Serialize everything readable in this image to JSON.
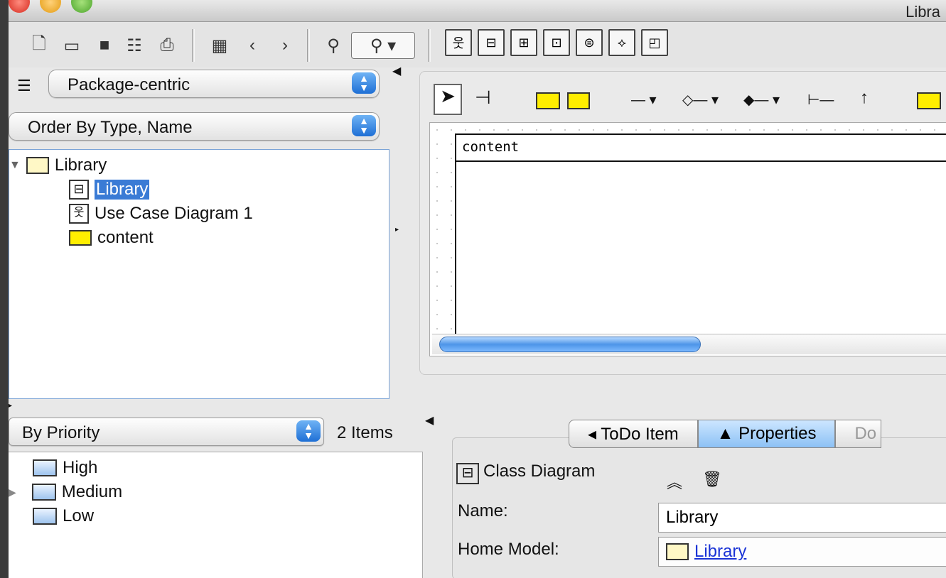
{
  "window": {
    "title": "Libra"
  },
  "toolbar": {
    "icons": [
      "new-diagram-icon",
      "open-icon",
      "save-icon",
      "properties-icon",
      "print-icon",
      "select-all-icon",
      "back-icon",
      "forward-icon",
      "find-icon",
      "zoom-icon",
      "usecase-diagram-icon",
      "class-diagram-icon",
      "sequence-diagram-icon",
      "collaboration-diagram-icon",
      "statechart-diagram-icon",
      "activity-diagram-icon",
      "deployment-diagram-icon"
    ]
  },
  "explorer": {
    "perspective": "Package-centric",
    "order": "Order By Type, Name",
    "tree": {
      "root": "Library",
      "children": [
        "Library",
        "Use Case Diagram 1",
        "content"
      ]
    }
  },
  "diagram": {
    "package_name": "content"
  },
  "todo": {
    "filter": "By Priority",
    "count": "2 Items",
    "items": [
      "High",
      "Medium",
      "Low"
    ]
  },
  "details": {
    "tabs": {
      "todo": "◂ ToDo Item",
      "properties": "▲ Properties",
      "third": "Do"
    },
    "type": "Class Diagram",
    "name_label": "Name:",
    "name_value": "Library",
    "home_label": "Home Model:",
    "home_value": "Library"
  }
}
